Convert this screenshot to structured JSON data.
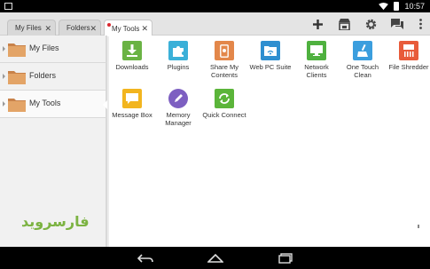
{
  "status_bar": {
    "time": "10:57"
  },
  "tabs": [
    {
      "label": "My Files",
      "close": "✕"
    },
    {
      "label": "Folders",
      "close": "✕"
    },
    {
      "label": "My Tools",
      "close": "✕"
    }
  ],
  "actions": {
    "new_icon": "plus-icon",
    "store_icon": "store-icon",
    "settings_icon": "gear-icon",
    "chat_icon": "chat-icon",
    "menu_icon": "overflow-menu-icon"
  },
  "sidebar": {
    "items": [
      {
        "label": "My Files"
      },
      {
        "label": "Folders"
      },
      {
        "label": "My Tools"
      }
    ],
    "watermark": "فارسروید"
  },
  "tools": [
    {
      "label": "Downloads",
      "icon": "download-icon",
      "color": "#6ab344"
    },
    {
      "label": "Plugins",
      "icon": "puzzle-icon",
      "color": "#3bb0d8"
    },
    {
      "label": "Share My Contents",
      "icon": "phone-share-icon",
      "color": "#e3874a"
    },
    {
      "label": "Web PC Suite",
      "icon": "folder-wifi-icon",
      "color": "#2f8fd0"
    },
    {
      "label": "Network Clients",
      "icon": "monitor-icon",
      "color": "#4fb13f"
    },
    {
      "label": "One Touch Clean",
      "icon": "broom-icon",
      "color": "#3b9ede"
    },
    {
      "label": "File Shredder",
      "icon": "shredder-icon",
      "color": "#e85b3a"
    },
    {
      "label": "Message Box",
      "icon": "message-icon",
      "color": "#f2b51f"
    },
    {
      "label": "Memory Manager",
      "icon": "pencil-icon",
      "color": "#7d5fc1"
    },
    {
      "label": "Quick Connect",
      "icon": "sync-icon",
      "color": "#5bb53a"
    }
  ],
  "nav": {
    "back": "back-icon",
    "home": "home-icon",
    "recents": "recents-icon"
  }
}
